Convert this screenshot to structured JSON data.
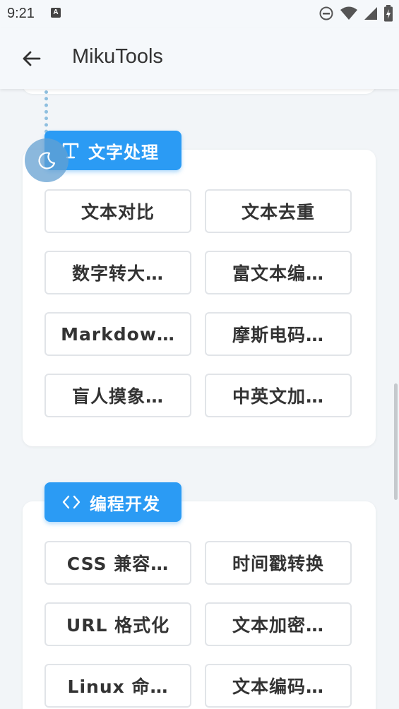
{
  "status_bar": {
    "time": "9:21",
    "notification_letter": "A",
    "icons": [
      "do-not-disturb-icon",
      "wifi-icon",
      "signal-icon",
      "battery-charging-icon"
    ]
  },
  "app_bar": {
    "title": "MikuTools",
    "back_icon": "arrow-left-icon"
  },
  "sections": [
    {
      "title": "文字处理",
      "icon": "text-t-icon",
      "tools": [
        "文本对比",
        "文本去重",
        "数字转大…",
        "富文本编…",
        "Markdow…",
        "摩斯电码…",
        "盲人摸象…",
        "中英文加…"
      ]
    },
    {
      "title": "编程开发",
      "icon": "code-brackets-icon",
      "tools": [
        "CSS 兼容…",
        "时间戳转换",
        "URL 格式化",
        "文本加密…",
        "Linux 命…",
        "文本编码…"
      ]
    }
  ],
  "colors": {
    "accent": "#2b9bf4",
    "background": "#f2f5f8",
    "card": "#ffffff",
    "button_border": "#e1e4e8",
    "text": "#333333"
  }
}
